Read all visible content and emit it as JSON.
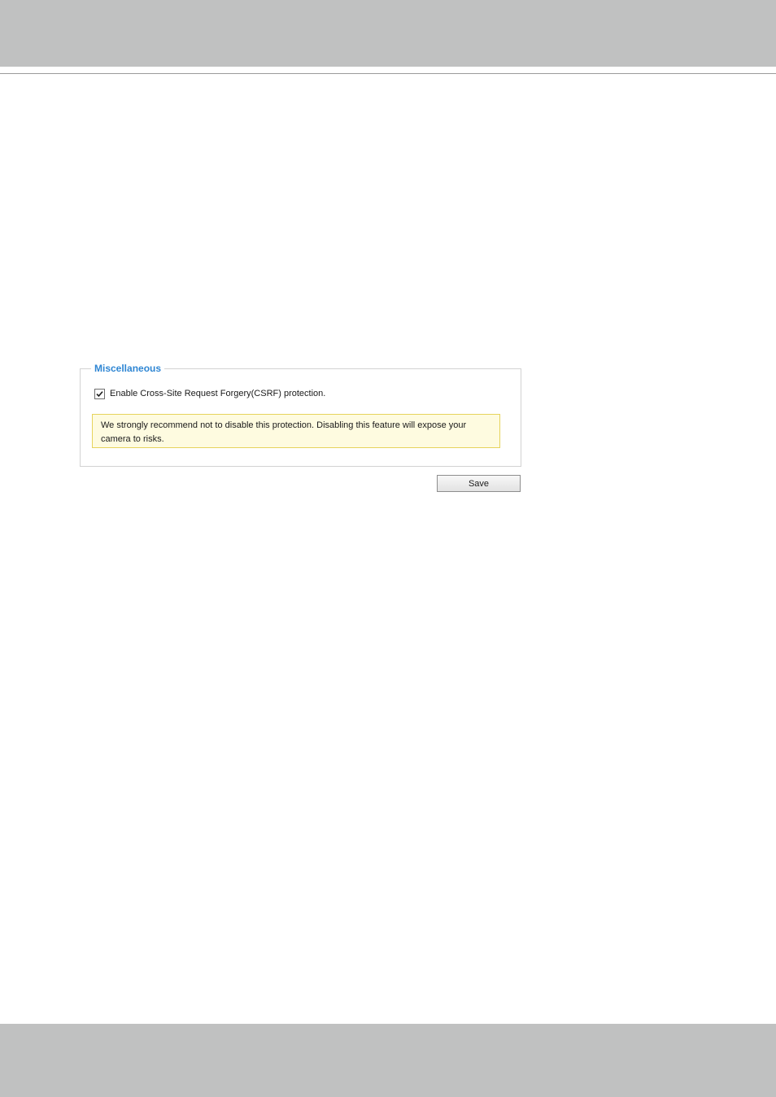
{
  "miscellaneous": {
    "legend": "Miscellaneous",
    "csrf_checkbox": {
      "label": "Enable Cross-Site Request Forgery(CSRF) protection.",
      "checked": true
    },
    "warning": "We strongly recommend not to disable this protection. Disabling this feature will expose your camera to risks."
  },
  "actions": {
    "save_label": "Save"
  },
  "colors": {
    "header_band": "#c0c1c1",
    "legend_accent": "#2f86d3",
    "warning_background": "#fefbe0",
    "warning_border": "#e6d35c"
  }
}
